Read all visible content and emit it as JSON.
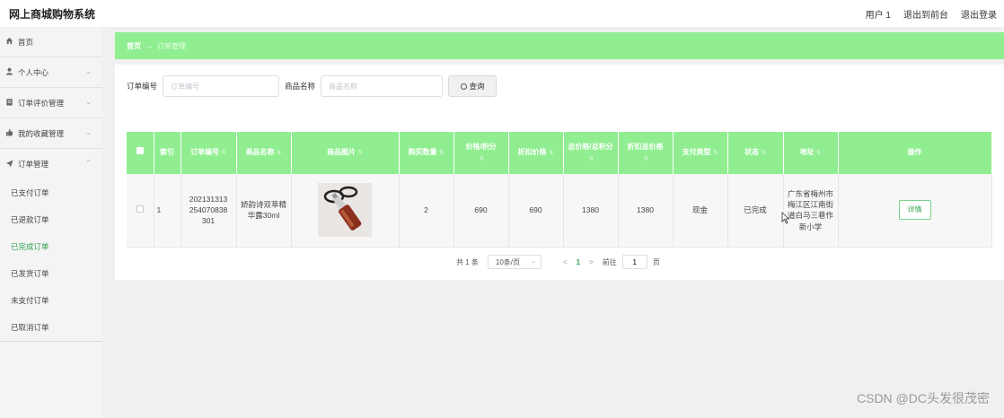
{
  "app": {
    "title": "网上商城购物系统"
  },
  "top_links": {
    "user": "用户 1",
    "back_front": "退出到前台",
    "logout": "退出登录"
  },
  "sidebar": {
    "items": [
      {
        "label": "首页",
        "icon": "home-icon"
      },
      {
        "label": "个人中心",
        "icon": "user-icon"
      },
      {
        "label": "订单评价管理",
        "icon": "clipboard-icon"
      },
      {
        "label": "我的收藏管理",
        "icon": "thumb-icon"
      },
      {
        "label": "订单管理",
        "icon": "send-icon"
      }
    ],
    "submenu": [
      {
        "label": "已支付订单",
        "active": false
      },
      {
        "label": "已退款订单",
        "active": false
      },
      {
        "label": "已完成订单",
        "active": true
      },
      {
        "label": "已发货订单",
        "active": false
      },
      {
        "label": "未支付订单",
        "active": false
      },
      {
        "label": "已取消订单",
        "active": false
      }
    ]
  },
  "breadcrumb": {
    "home": "首页",
    "arrow": "→",
    "current": "订单管理"
  },
  "search": {
    "order_no_label": "订单编号",
    "order_no_placeholder": "订单编号",
    "product_name_label": "商品名称",
    "product_name_placeholder": "商品名称",
    "query_label": "查询"
  },
  "table": {
    "headers": [
      "索引",
      "订单编号",
      "商品名称",
      "商品图片",
      "购买数量",
      "价格/积分",
      "折扣价格",
      "总价格/总积分",
      "折扣总价格",
      "支付类型",
      "状态",
      "地址",
      "操作"
    ],
    "rows": [
      {
        "index": "1",
        "order_no": "2021313132540708383 01",
        "order_no_display": "202131313\n254070838\n301",
        "product_name": "娇韵诗双萃精华露30ml",
        "quantity": "2",
        "price": "690",
        "discount_price": "690",
        "total": "1380",
        "discount_total": "1380",
        "pay_type": "现金",
        "status": "已完成",
        "address": "广东省梅州市梅江区江南街道白马三巷作新小学",
        "action": "详情"
      }
    ]
  },
  "pagination": {
    "total": "共 1 条",
    "page_size": "10条/页",
    "current_page": "1",
    "goto_label": "前往",
    "goto_value": "1",
    "page_unit": "页"
  },
  "watermark": "CSDN @DC头发很茂密",
  "colors": {
    "accent": "#90ee90",
    "active_text": "#2ea14a"
  }
}
